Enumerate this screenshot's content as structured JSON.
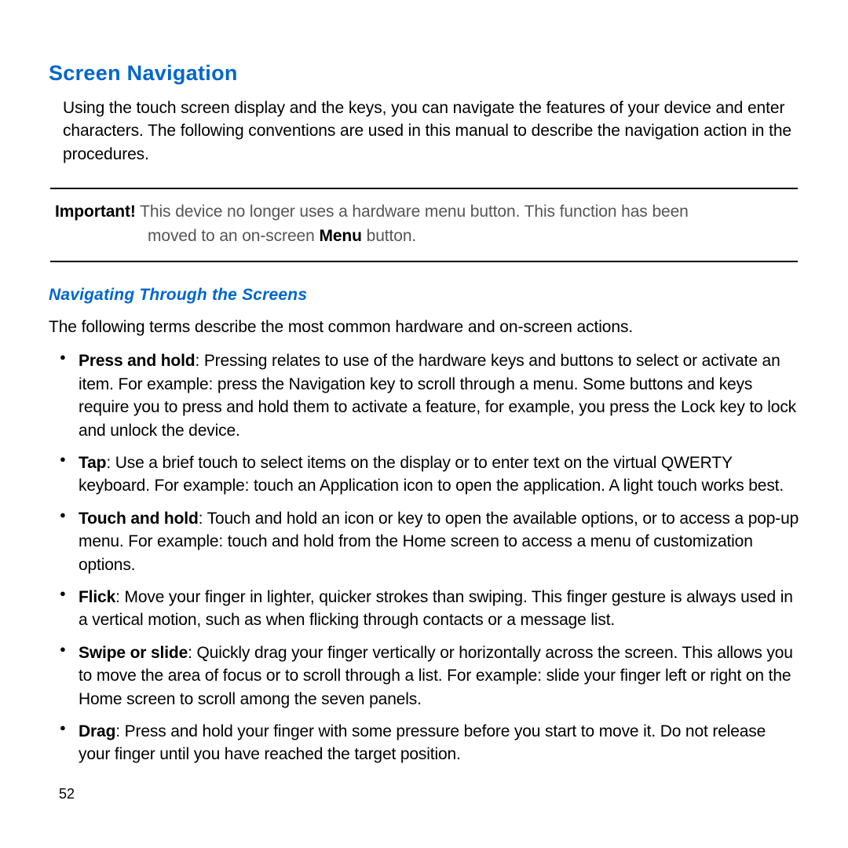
{
  "title": "Screen Navigation",
  "intro": "Using the touch screen display and the keys, you can navigate the features of your device and enter characters. The following conventions are used in this manual to describe the navigation action in the procedures.",
  "callout": {
    "label": "Important!",
    "line1_before": " This device no longer uses a hardware menu button. This function has been",
    "line2_prefix": "moved to an on-screen  ",
    "menu_word": "Menu",
    "line2_suffix": " button."
  },
  "sub_title": "Navigating Through the Screens",
  "sub_intro": "The following terms describe the most common hardware and on-screen actions.",
  "items": [
    {
      "term": "Press and hold",
      "desc": ": Pressing relates to use of the hardware keys and buttons to select or activate an item. For example: press the Navigation key to scroll through a menu. Some buttons and keys require you to press and hold them to activate a feature, for example, you press the Lock key to lock and unlock the device."
    },
    {
      "term": "Tap",
      "desc": ": Use a brief touch to select items on the display or to enter text on the virtual QWERTY keyboard. For example: touch an Application icon to open the application. A light touch works best."
    },
    {
      "term": "Touch and hold",
      "desc": ": Touch and hold an icon or key to open the available options, or to access a pop-up menu. For example: touch and hold from the Home screen to access a menu of customization options."
    },
    {
      "term": "Flick",
      "desc": ": Move your finger in lighter, quicker strokes than swiping. This finger gesture is always used in a vertical motion, such as when flicking through contacts or a message list."
    },
    {
      "term": "Swipe or slide",
      "desc": ": Quickly drag your finger vertically or horizontally across the screen. This allows you to move the area of focus or to scroll through a list. For example: slide your finger left or right on the Home screen to scroll among the seven panels."
    },
    {
      "term": "Drag",
      "desc": ": Press and hold your finger with some pressure before you start to move it. Do not release your finger until you have reached the target position."
    }
  ],
  "page_number": "52"
}
